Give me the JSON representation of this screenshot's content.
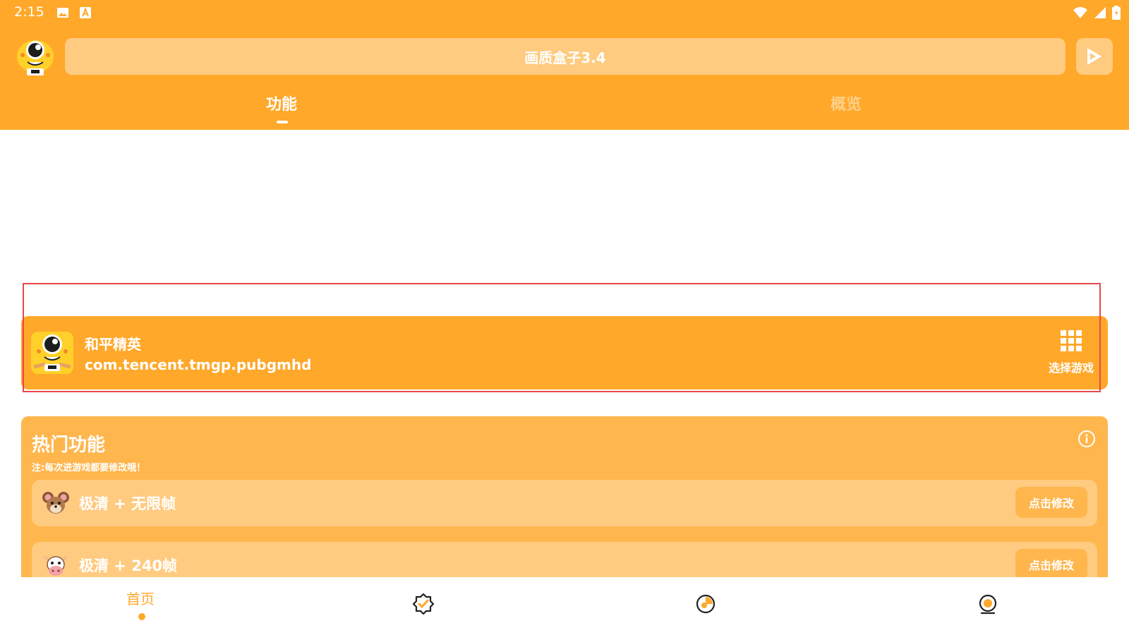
{
  "status_bar": {
    "time": "2:15",
    "left_icons": [
      "image-icon",
      "a-text-icon"
    ],
    "right_icons": [
      "wifi-icon",
      "signal-icon",
      "battery-icon"
    ]
  },
  "header": {
    "title": "画质盒子3.4",
    "logo_icon": "mascot-logo",
    "play_icon": "play-icon",
    "tabs": [
      {
        "label": "功能",
        "active": true
      },
      {
        "label": "概览",
        "active": false
      }
    ]
  },
  "game_card": {
    "name": "和平精英",
    "package": "com.tencent.tmgp.pubgmhd",
    "select_label": "选择游戏",
    "select_icon": "grid-icon"
  },
  "hot_features": {
    "title": "热门功能",
    "note": "注:每次进游戏都要修改哦！",
    "info_icon": "info-icon",
    "items": [
      {
        "label": "极清 + 无限帧",
        "button": "点击修改",
        "icon": "mouse-avatar-icon"
      },
      {
        "label": "极清 + 240帧",
        "button": "点击修改",
        "icon": "cow-avatar-icon"
      }
    ]
  },
  "bottom_nav": {
    "items": [
      {
        "label": "首页",
        "icon": "home-label",
        "active": true
      },
      {
        "label": "",
        "icon": "verified-badge-icon",
        "active": false
      },
      {
        "label": "",
        "icon": "pie-chart-icon",
        "active": false
      },
      {
        "label": "",
        "icon": "user-profile-icon",
        "active": false
      }
    ]
  },
  "colors": {
    "primary": "#ffa82a",
    "panel": "#ffb64d",
    "light": "#ffcb80",
    "highlight": "#e8484a"
  }
}
